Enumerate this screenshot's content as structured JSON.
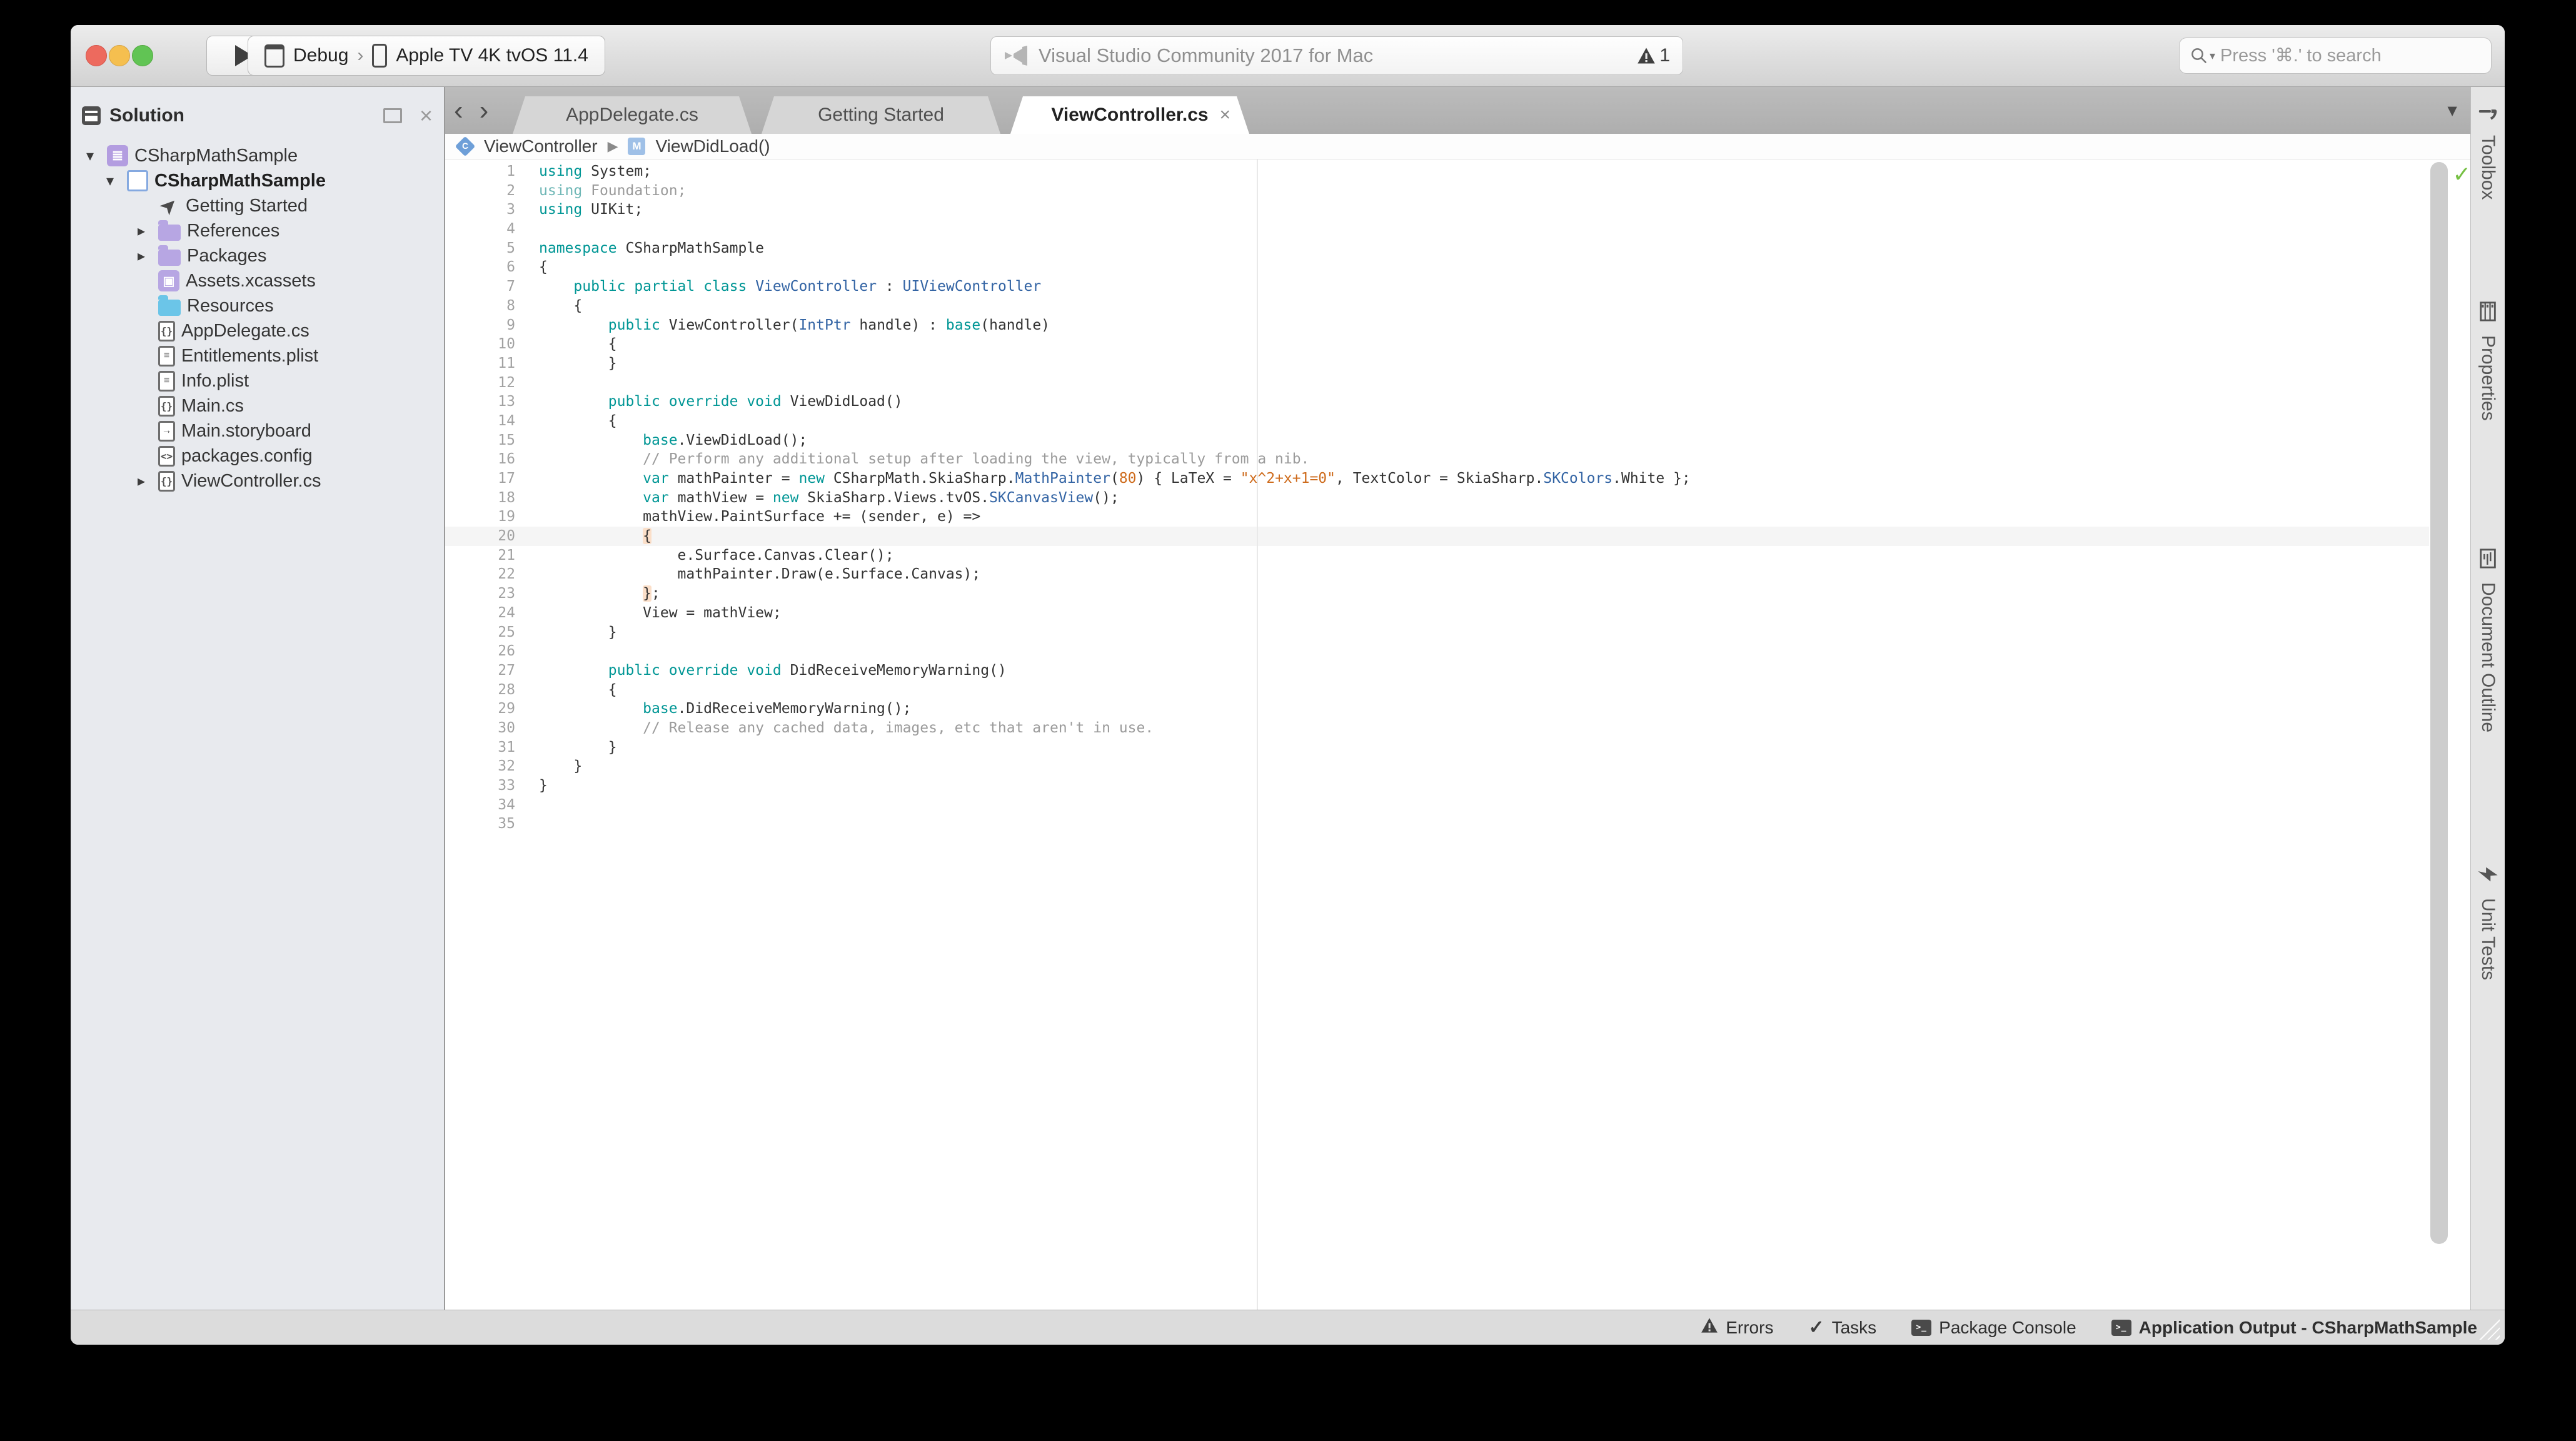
{
  "titlebar": {
    "configuration": "Debug",
    "device": "Apple TV 4K tvOS 11.4",
    "app_title": "Visual Studio Community 2017 for Mac",
    "warning_count": "1",
    "search_placeholder": "Press '⌘.' to search"
  },
  "sidebar": {
    "title": "Solution",
    "items": [
      {
        "level": 0,
        "chevron": "down",
        "icon": "solution",
        "label": "CSharpMathSample",
        "bold": false
      },
      {
        "level": 1,
        "chevron": "down",
        "icon": "project",
        "label": "CSharpMathSample",
        "bold": true
      },
      {
        "level": 2,
        "chevron": null,
        "icon": "rocket",
        "label": "Getting Started",
        "bold": false
      },
      {
        "level": 2,
        "chevron": "right",
        "icon": "folder-purple",
        "label": "References",
        "bold": false
      },
      {
        "level": 2,
        "chevron": "right",
        "icon": "folder-purple",
        "label": "Packages",
        "bold": false
      },
      {
        "level": 2,
        "chevron": null,
        "icon": "assets",
        "label": "Assets.xcassets",
        "bold": false
      },
      {
        "level": 2,
        "chevron": null,
        "icon": "folder-cyan",
        "label": "Resources",
        "bold": false
      },
      {
        "level": 2,
        "chevron": null,
        "icon": "cs-file",
        "label": "AppDelegate.cs",
        "bold": false
      },
      {
        "level": 2,
        "chevron": null,
        "icon": "plist-file",
        "label": "Entitlements.plist",
        "bold": false
      },
      {
        "level": 2,
        "chevron": null,
        "icon": "plist-file",
        "label": "Info.plist",
        "bold": false
      },
      {
        "level": 2,
        "chevron": null,
        "icon": "cs-file",
        "label": "Main.cs",
        "bold": false
      },
      {
        "level": 2,
        "chevron": null,
        "icon": "storyboard-file",
        "label": "Main.storyboard",
        "bold": false
      },
      {
        "level": 2,
        "chevron": null,
        "icon": "config-file",
        "label": "packages.config",
        "bold": false
      },
      {
        "level": 2,
        "chevron": "right",
        "icon": "cs-file",
        "label": "ViewController.cs",
        "bold": false
      }
    ]
  },
  "editor": {
    "tabs": [
      {
        "label": "AppDelegate.cs",
        "active": false,
        "closable": false
      },
      {
        "label": "Getting Started",
        "active": false,
        "closable": false
      },
      {
        "label": "ViewController.cs",
        "active": true,
        "closable": true
      }
    ],
    "breadcrumb": [
      {
        "icon": "class-badge",
        "badge": "C",
        "label": "ViewController"
      },
      {
        "icon": "method-badge",
        "badge": "M",
        "label": "ViewDidLoad()"
      }
    ],
    "current_line": 20,
    "total_lines": 35,
    "analysis_status": "ok"
  },
  "code": {
    "lines": [
      [
        [
          "k",
          "using"
        ],
        [
          "p",
          " System;"
        ]
      ],
      [
        [
          "kf",
          "using"
        ],
        [
          "g",
          " Foundation;"
        ]
      ],
      [
        [
          "k",
          "using"
        ],
        [
          "p",
          " UIKit;"
        ]
      ],
      [],
      [
        [
          "k",
          "namespace"
        ],
        [
          "p",
          " CSharpMathSample"
        ]
      ],
      [
        [
          "p",
          "{"
        ]
      ],
      [
        [
          "p",
          "    "
        ],
        [
          "k",
          "public partial class"
        ],
        [
          "p",
          " "
        ],
        [
          "t",
          "ViewController"
        ],
        [
          "p",
          " : "
        ],
        [
          "t",
          "UIViewController"
        ]
      ],
      [
        [
          "p",
          "    {"
        ]
      ],
      [
        [
          "p",
          "        "
        ],
        [
          "k",
          "public"
        ],
        [
          "p",
          " ViewController("
        ],
        [
          "t",
          "IntPtr"
        ],
        [
          "p",
          " handle) : "
        ],
        [
          "k",
          "base"
        ],
        [
          "p",
          "(handle)"
        ]
      ],
      [
        [
          "p",
          "        {"
        ]
      ],
      [
        [
          "p",
          "        }"
        ]
      ],
      [],
      [
        [
          "p",
          "        "
        ],
        [
          "k",
          "public override void"
        ],
        [
          "p",
          " ViewDidLoad()"
        ]
      ],
      [
        [
          "p",
          "        {"
        ]
      ],
      [
        [
          "p",
          "            "
        ],
        [
          "k",
          "base"
        ],
        [
          "p",
          ".ViewDidLoad();"
        ]
      ],
      [
        [
          "p",
          "            "
        ],
        [
          "g",
          "// Perform any additional setup after loading the view, typically from a nib."
        ]
      ],
      [
        [
          "p",
          "            "
        ],
        [
          "k",
          "var"
        ],
        [
          "p",
          " mathPainter = "
        ],
        [
          "k",
          "new"
        ],
        [
          "p",
          " CSharpMath.SkiaSharp."
        ],
        [
          "t",
          "MathPainter"
        ],
        [
          "p",
          "("
        ],
        [
          "o",
          "80"
        ],
        [
          "p",
          ") { LaTeX = "
        ],
        [
          "o",
          "\"x^2+x+1=0\""
        ],
        [
          "p",
          ", TextColor = SkiaSharp."
        ],
        [
          "t",
          "SKColors"
        ],
        [
          "p",
          ".White };"
        ]
      ],
      [
        [
          "p",
          "            "
        ],
        [
          "k",
          "var"
        ],
        [
          "p",
          " mathView = "
        ],
        [
          "k",
          "new"
        ],
        [
          "p",
          " SkiaSharp.Views.tvOS."
        ],
        [
          "t",
          "SKCanvasView"
        ],
        [
          "p",
          "();"
        ]
      ],
      [
        [
          "p",
          "            mathView.PaintSurface += (sender, e) =>"
        ]
      ],
      [
        [
          "p",
          "            "
        ],
        [
          "bh",
          "{"
        ]
      ],
      [
        [
          "p",
          "                e.Surface.Canvas.Clear();"
        ]
      ],
      [
        [
          "p",
          "                mathPainter.Draw(e.Surface.Canvas);"
        ]
      ],
      [
        [
          "p",
          "            "
        ],
        [
          "bh",
          "}"
        ],
        [
          "p",
          ";"
        ]
      ],
      [
        [
          "p",
          "            View = mathView;"
        ]
      ],
      [
        [
          "p",
          "        }"
        ]
      ],
      [],
      [
        [
          "p",
          "        "
        ],
        [
          "k",
          "public override void"
        ],
        [
          "p",
          " DidReceiveMemoryWarning()"
        ]
      ],
      [
        [
          "p",
          "        {"
        ]
      ],
      [
        [
          "p",
          "            "
        ],
        [
          "k",
          "base"
        ],
        [
          "p",
          ".DidReceiveMemoryWarning();"
        ]
      ],
      [
        [
          "p",
          "            "
        ],
        [
          "g",
          "// Release any cached data, images, etc that aren't in use."
        ]
      ],
      [
        [
          "p",
          "        }"
        ]
      ],
      [
        [
          "p",
          "    }"
        ]
      ],
      [
        [
          "p",
          "}"
        ]
      ],
      [],
      []
    ]
  },
  "right_dock": {
    "items": [
      {
        "icon": "hammer-icon",
        "label": "Toolbox"
      },
      {
        "icon": "properties-icon",
        "label": "Properties"
      },
      {
        "icon": "outline-icon",
        "label": "Document Outline"
      },
      {
        "icon": "bolt-icon",
        "label": "Unit Tests"
      }
    ]
  },
  "statusbar": {
    "items": [
      {
        "icon": "warning-icon",
        "label": "Errors",
        "bold": false
      },
      {
        "icon": "check-icon",
        "label": "Tasks",
        "bold": false
      },
      {
        "icon": "terminal-icon",
        "label": "Package Console",
        "bold": false
      },
      {
        "icon": "terminal-icon",
        "label": "Application Output - CSharpMathSample",
        "bold": true
      }
    ]
  },
  "colors": {
    "keyword": "#009695",
    "keyword_faded": "#6fb7b6",
    "user_type": "#3364a4",
    "literal": "#ce6b1c",
    "comment": "#9b9b9b",
    "analysis_ok_check": "#76c043",
    "traffic_red": "#ed6a5e",
    "traffic_yellow": "#f5bf4f",
    "traffic_green": "#61c454"
  }
}
